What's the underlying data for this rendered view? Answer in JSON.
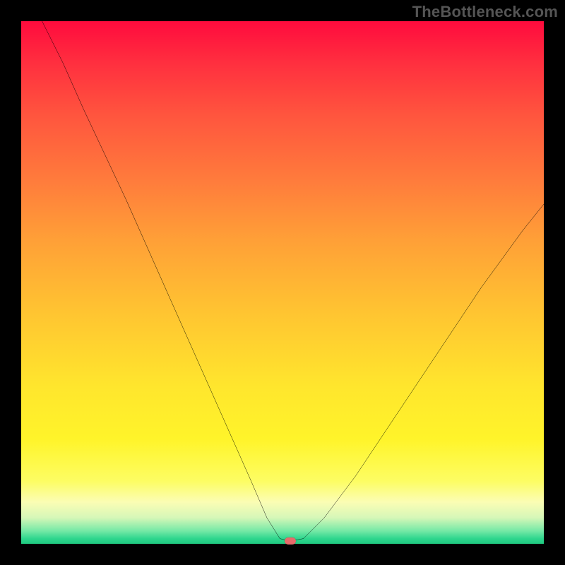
{
  "attribution": "TheBottleneck.com",
  "chart_data": {
    "type": "line",
    "title": "",
    "xlabel": "",
    "ylabel": "",
    "xlim": [
      0,
      100
    ],
    "ylim": [
      0,
      100
    ],
    "x": [
      4,
      8,
      12,
      16,
      20,
      24,
      28,
      32,
      36,
      40,
      44,
      47,
      49.5,
      51.5,
      54,
      58,
      64,
      72,
      80,
      88,
      96,
      100
    ],
    "y": [
      100,
      92,
      83,
      74.5,
      66,
      57,
      48,
      39,
      30,
      21,
      12,
      5,
      1,
      0.5,
      1,
      5,
      13,
      25,
      37,
      49,
      60,
      65
    ],
    "marker": {
      "x": 51.5,
      "y": 0.5
    },
    "colors": {
      "curve": "#000000",
      "marker": "#e76a6a",
      "gradient_top": "#ff0b3d",
      "gradient_mid": "#ffe62d",
      "gradient_bottom": "#1fc97f"
    }
  }
}
